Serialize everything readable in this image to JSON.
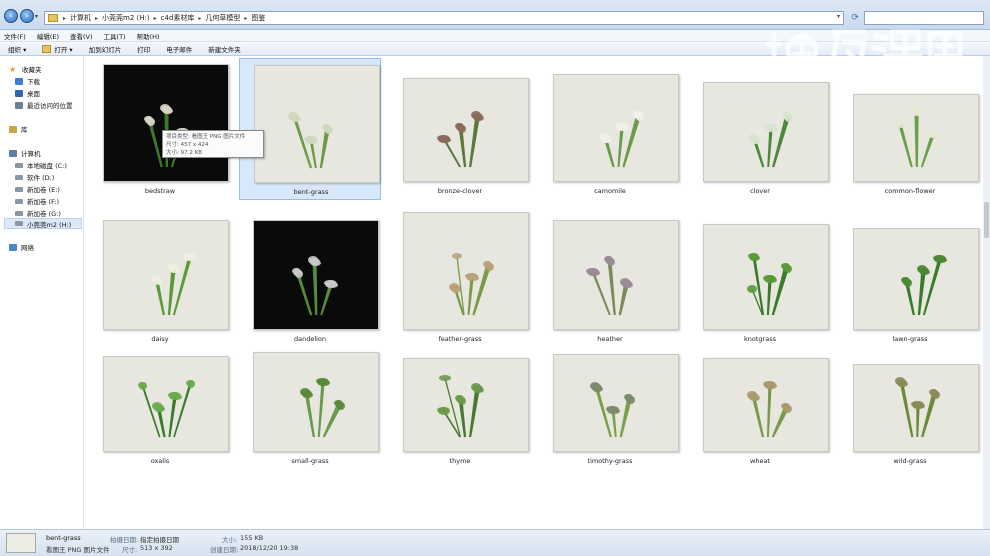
{
  "address": {
    "crumbs": [
      "计算机",
      "小莞莞m2 (H:)",
      "c4d素材库",
      "几何草模型",
      "图鉴"
    ]
  },
  "menu": [
    "文件(F)",
    "编辑(E)",
    "查看(V)",
    "工具(T)",
    "帮助(H)"
  ],
  "toolbar": [
    "组织 ▾",
    "打开 ▾",
    "加到幻灯片",
    "打印",
    "电子邮件",
    "新建文件夹"
  ],
  "sidebar": {
    "favorites": "收藏夹",
    "downloads": "下载",
    "desktop": "桌面",
    "recent": "最近访问的位置",
    "libraries": "库",
    "computer": "计算机",
    "drives": [
      "本地磁盘 (C:)",
      "软件 (D:)",
      "新加卷 (E:)",
      "新加卷 (F:)",
      "新加卷 (G:)",
      "小莞莞m2 (H:)"
    ],
    "network": "网络"
  },
  "files": [
    {
      "name": "bedstraw",
      "bg": "dark",
      "plant": "#d9d3c6",
      "stem": "#3c7a2a"
    },
    {
      "name": "bent-grass",
      "bg": "light",
      "plant": "#cfd8bf",
      "stem": "#6f9a4a"
    },
    {
      "name": "bronze-clover",
      "bg": "light",
      "plant": "#8a6a5a",
      "stem": "#5a7a3a"
    },
    {
      "name": "camomile",
      "bg": "light",
      "plant": "#f2f0ea",
      "stem": "#6a9a4a"
    },
    {
      "name": "clover",
      "bg": "light",
      "plant": "#d8e2d0",
      "stem": "#4a8a3a"
    },
    {
      "name": "common-flower",
      "bg": "light",
      "plant": "#e4e8d4",
      "stem": "#6aa04a"
    },
    {
      "name": "daisy",
      "bg": "light",
      "plant": "#eef0e0",
      "stem": "#5a9a3a"
    },
    {
      "name": "dandelion",
      "bg": "dark",
      "plant": "#c8c8c8",
      "stem": "#5a8a3a"
    },
    {
      "name": "feather-grass",
      "bg": "light",
      "plant": "#b8a27a",
      "stem": "#7a9a4a"
    },
    {
      "name": "heather",
      "bg": "light",
      "plant": "#9a8a96",
      "stem": "#7a8a5a"
    },
    {
      "name": "knotgrass",
      "bg": "light",
      "plant": "#5a9a3a",
      "stem": "#3a7a2a"
    },
    {
      "name": "lawn-grass",
      "bg": "light",
      "plant": "#4a8a32",
      "stem": "#3a7a2a"
    },
    {
      "name": "oxalis",
      "bg": "light",
      "plant": "#6aaa4a",
      "stem": "#3a7a2a"
    },
    {
      "name": "small-grass",
      "bg": "light",
      "plant": "#5a8a3a",
      "stem": "#6a9a4a"
    },
    {
      "name": "thyme",
      "bg": "light",
      "plant": "#6a9a4a",
      "stem": "#4a7a32"
    },
    {
      "name": "timothy-grass",
      "bg": "light",
      "plant": "#7a8a6a",
      "stem": "#7aa04a"
    },
    {
      "name": "wheat",
      "bg": "light",
      "plant": "#a89a6a",
      "stem": "#7a9a4a"
    },
    {
      "name": "wild-grass",
      "bg": "light",
      "plant": "#8a8a5a",
      "stem": "#6a8a3a"
    }
  ],
  "tooltip": {
    "type": "项目类型: 看图王 PNG 图片文件",
    "dims": "尺寸: 457 x 424",
    "size": "大小: 97.2 KB"
  },
  "details": {
    "filename": "bent-grass",
    "filetype": "看图王 PNG 图片文件",
    "shot_label": "拍摄日期:",
    "shot_value": "指定拍摄日期",
    "dims_label": "尺寸:",
    "dims_value": "513 x 392",
    "size_label": "大小:",
    "size_value": "155 KB",
    "created_label": "创建日期:",
    "created_value": "2018/12/20 19:38"
  },
  "colors": {
    "selection": "#d8e8fb",
    "accent": "#2d6fbf"
  }
}
